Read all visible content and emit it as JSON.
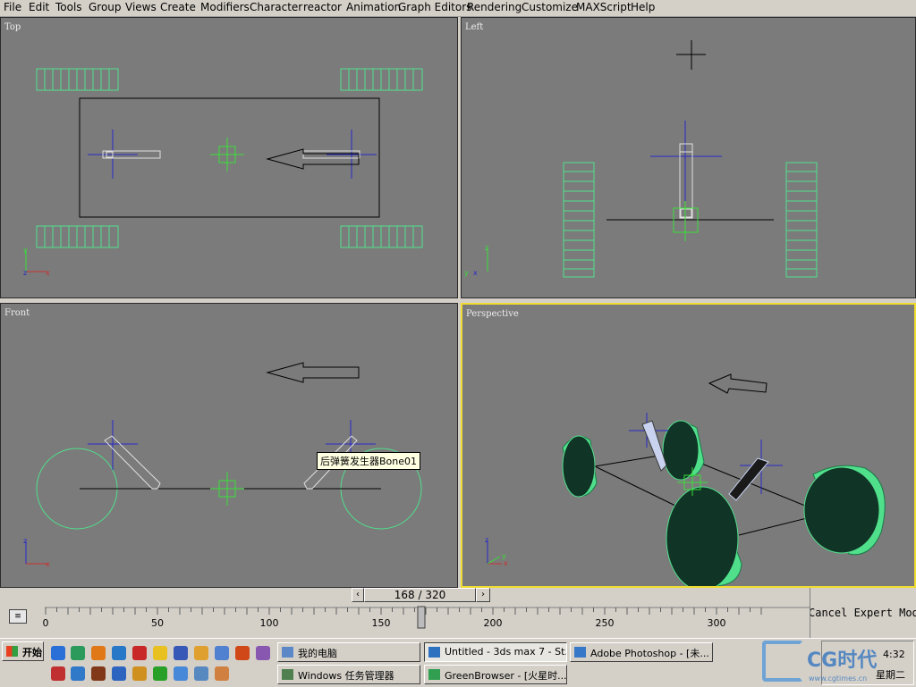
{
  "menu": [
    "File",
    "Edit",
    "Tools",
    "Group",
    "Views",
    "Create",
    "Modifiers",
    "Character",
    "reactor",
    "Animation",
    "Graph Editors",
    "Rendering",
    "Customize",
    "MAXScript",
    "Help"
  ],
  "viewports": {
    "top": {
      "label": "Top"
    },
    "left": {
      "label": "Left"
    },
    "front": {
      "label": "Front"
    },
    "perspective": {
      "label": "Perspective"
    }
  },
  "tooltip": "后弹簧发生器Bone01",
  "timeslider": {
    "current": "168",
    "separator": "/",
    "total": "320",
    "display": "168 / 320",
    "frame": 168,
    "max": 320
  },
  "timeline": {
    "ticks": [
      "0",
      "50",
      "100",
      "150",
      "200",
      "250",
      "300"
    ]
  },
  "status": "Cancel Expert Mode",
  "taskbar": {
    "start_label": "开始",
    "buttons": [
      "我的电脑",
      "Untitled - 3ds max 7 - St...",
      "Adobe Photoshop - [未...",
      "Windows 任务管理器",
      "GreenBrowser - [火星时..."
    ],
    "clock": "4:32",
    "weekday": "星期二"
  },
  "watermark": {
    "text": "CG时代",
    "url": "www.cgtimes.cn"
  },
  "colors": {
    "viewport_bg": "#7b7b7b",
    "active_border": "#f0dc30",
    "wheel_green": "#50e08c",
    "helper_green": "#38e038",
    "bone_blue": "#2828c8"
  }
}
